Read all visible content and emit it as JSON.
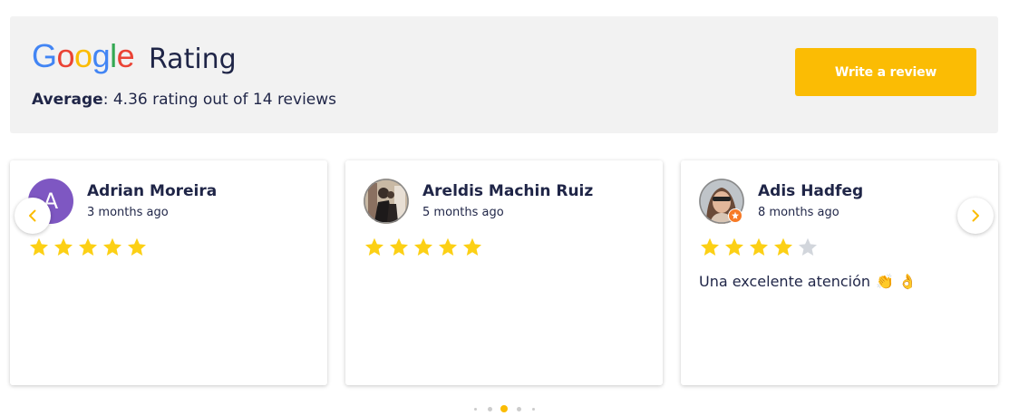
{
  "header": {
    "brand": [
      "G",
      "o",
      "o",
      "g",
      "l",
      "e"
    ],
    "brand_colors": [
      "#4285F4",
      "#EA4335",
      "#FBBC05",
      "#4285F4",
      "#34A853",
      "#EA4335"
    ],
    "title": "Rating",
    "average_label": "Average",
    "average_text": ": 4.36 rating out of 14 reviews",
    "write_review_label": "Write a review"
  },
  "colors": {
    "accent": "#fbbc04",
    "star_filled": "#fcd015",
    "star_empty": "#d2d6dc",
    "text": "#1f2547"
  },
  "reviews": [
    {
      "name": "Adrian Moreira",
      "time": "3 months ago",
      "avatar_letter": "A",
      "rating": 5,
      "text": ""
    },
    {
      "name": "Areldis Machin Ruiz",
      "time": "5 months ago",
      "avatar_letter": "",
      "rating": 5,
      "text": ""
    },
    {
      "name": "Adis Hadfeg",
      "time": "8 months ago",
      "avatar_letter": "",
      "rating": 4,
      "text": "Una excelente atención",
      "emojis": "👏 👌"
    }
  ],
  "carousel": {
    "prev_icon": "chevron-left-icon",
    "next_icon": "chevron-right-icon",
    "dot_count": 5,
    "active_dot": 2
  }
}
